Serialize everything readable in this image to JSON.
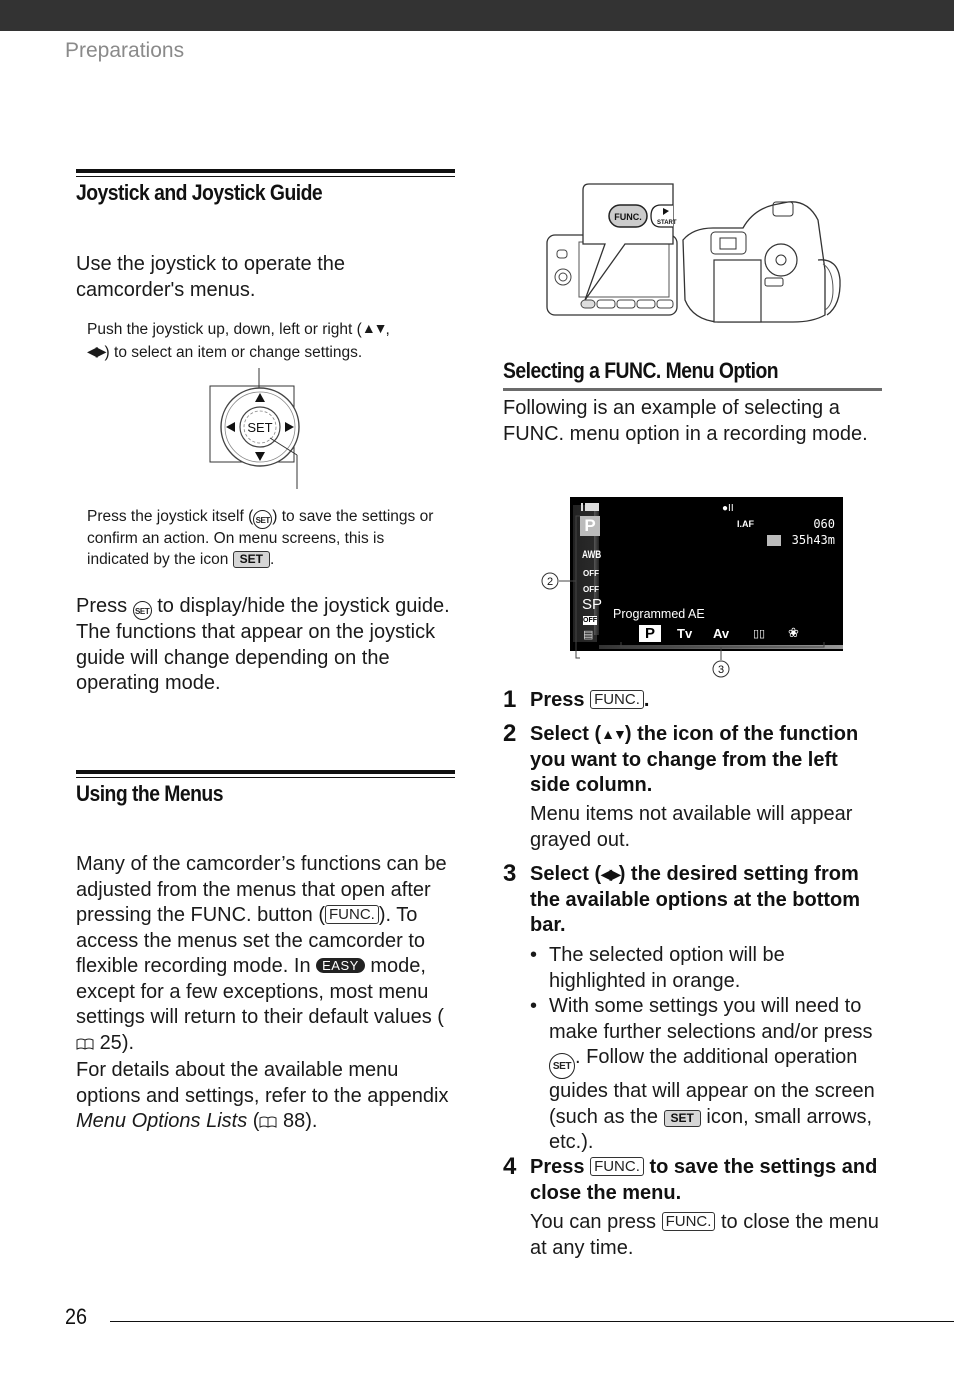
{
  "header": {
    "section": "Preparations"
  },
  "joystick_section": {
    "title": "Joystick and Joystick Guide",
    "intro": "Use the joystick to operate the camcorder's menus.",
    "push_note_a": "Push the joystick up, down, left or right (",
    "push_note_updown": "▲▼",
    "push_note_b": ",",
    "push_note_leftright": "◀▶",
    "push_note_c": ") to select an item or change settings.",
    "joystick_center_label": "SET",
    "press_note_a": "Press the joystick itself (",
    "press_note_set": "SET",
    "press_note_b": ") to save the settings or confirm an action. On menu screens, this is indicated by the icon",
    "press_note_badge": "SET",
    "press_note_c": ".",
    "guide_a": "Press",
    "guide_set": "SET",
    "guide_b": "to display/hide the joystick guide. The functions that appear on the joystick guide will change depending on the operating mode."
  },
  "menus_section": {
    "title": "Using the Menus",
    "p1_a": "Many of the camcorder’s functions can be adjusted from the menus that open after pressing the FUNC. button (",
    "p1_func": "FUNC.",
    "p1_b": "). To access the menus set the camcorder to flexible recording mode. In",
    "p1_easy": "EASY",
    "p1_c": "mode, except for a few exceptions, most menu settings will return to their default values (",
    "p1_page": "25",
    "p1_d": ").",
    "p2_a": "For details about the available menu options and settings, refer to the appendix",
    "p2_italic": "Menu Options Lists",
    "p2_b": "(",
    "p2_page": "88",
    "p2_c": ")."
  },
  "camcorder_illustration": {
    "callout_func": "FUNC.",
    "callout_start": "START"
  },
  "func_section": {
    "title": "Selecting a FUNC. Menu Option",
    "intro": "Following is an example of selecting a FUNC. menu option in a recording mode.",
    "lcd": {
      "record_indicator": "●II",
      "af_mode": "I.AF",
      "counter": "060",
      "remaining": "35h43m",
      "left_column": [
        "P",
        "AWB",
        "OFF",
        "OFF",
        "SP",
        "OFF",
        "▤"
      ],
      "selected_label": "Programmed AE",
      "bottom_options": [
        "P",
        "Tv",
        "Av",
        "▯▯",
        "❀"
      ],
      "callout_left": "2",
      "callout_bottom": "3"
    },
    "steps": [
      {
        "num": "1",
        "title_a": "Press",
        "title_func": "FUNC.",
        "title_b": "."
      },
      {
        "num": "2",
        "title_a": "Select (",
        "title_arrows": "▲▼",
        "title_b": ") the icon of the function you want to change from the left side column.",
        "body": "Menu items not available will appear grayed out."
      },
      {
        "num": "3",
        "title_a": "Select (",
        "title_arrows": "◀▶",
        "title_b": ") the desired setting from the available options at the bottom bar.",
        "bullets": [
          {
            "text": "The selected option will be highlighted in orange."
          },
          {
            "text_a": "With some settings you will need to make further selections and/or press",
            "set": "SET",
            "text_b": ". Follow the additional operation guides that will appear on the screen (such as the",
            "badge": "SET",
            "text_c": "icon, small arrows, etc.)."
          }
        ],
        "bullet_char": "•"
      },
      {
        "num": "4",
        "title_a": "Press",
        "title_func": "FUNC.",
        "title_b": "to save the settings and close the menu.",
        "body_a": "You can press",
        "body_func": "FUNC.",
        "body_b": "to close the menu at any time."
      }
    ]
  },
  "footer": {
    "page_number": "26"
  }
}
